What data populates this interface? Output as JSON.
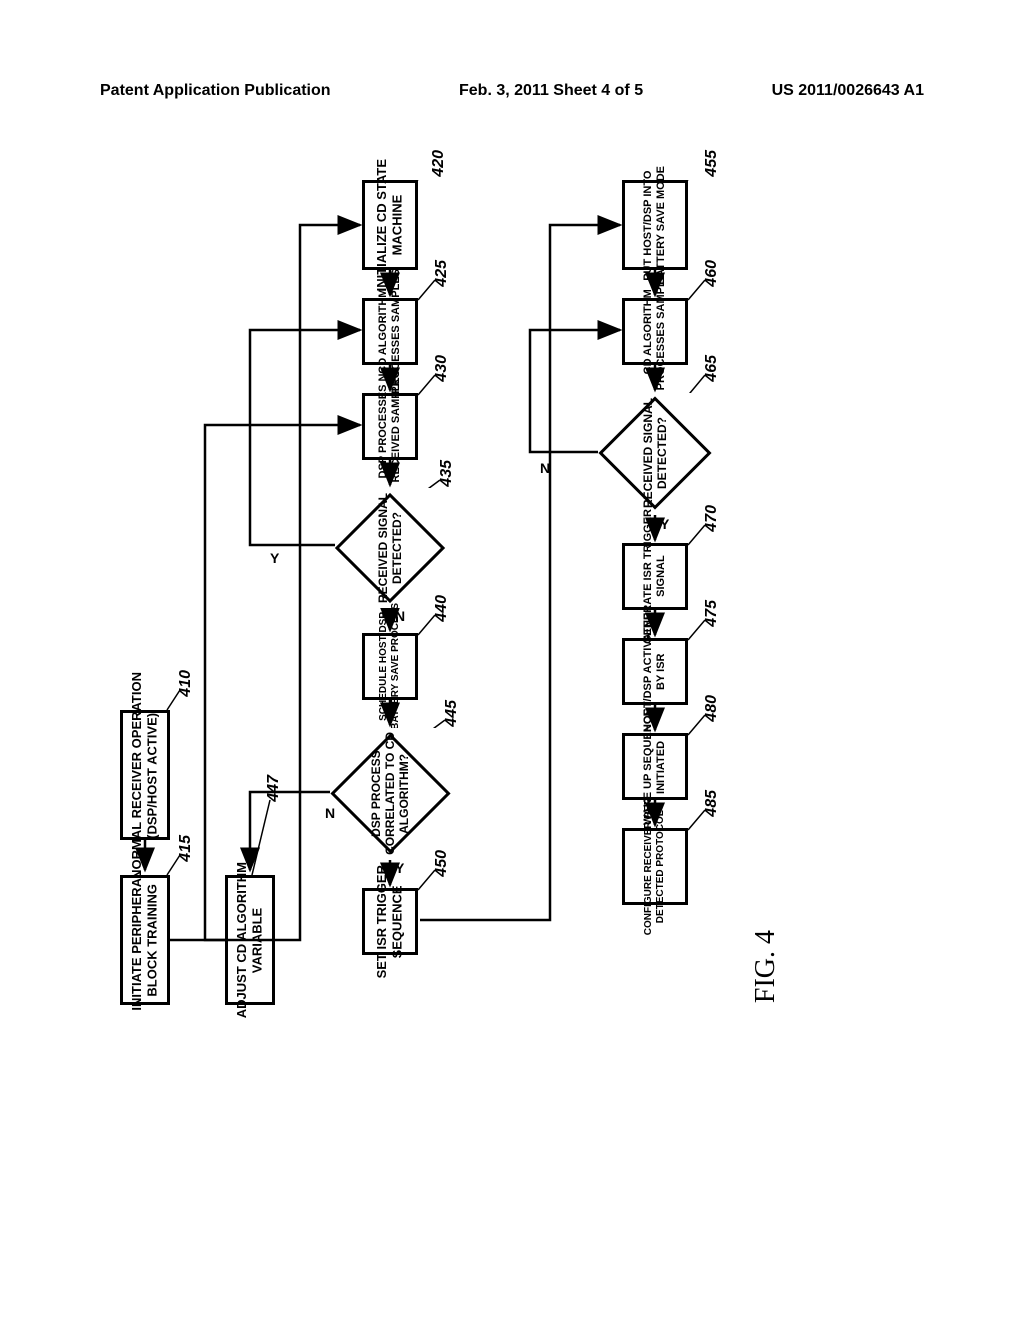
{
  "header": {
    "left": "Patent Application Publication",
    "center": "Feb. 3, 2011  Sheet 4 of 5",
    "right": "US 2011/0026643 A1"
  },
  "figure_label": "FIG. 4",
  "boxes": {
    "b410": "NORMAL RECEIVER OPERATION\n(DSP/HOST ACTIVE)",
    "b415": "INITIATE PERIPHERAL\nBLOCK TRAINING",
    "b420": "INITIALIZE CD STATE\nMACHINE",
    "b425": "CD ALGORITHM\nPROCESSES SAMPLES",
    "b430": "DSP PROCESSES N\nRECEIVED SAMPLES",
    "b435": "RECEIVED SIGNAL\nDETECTED?",
    "b440": "SCHEDULE HOST/DSP\nBATTERY SAVE PROCESS",
    "b445": "DSP PROCESS\nCORRELATED TO CD\nALGORITHM?",
    "b447": "ADJUST CD ALGORITHM\nVARIABLE",
    "b450": "SET ISR TRIGGER\nSEQUENCE",
    "b455": "PUT HOST/DSP INTO\nBATTERY SAVE MODE",
    "b460": "CD ALGORITHM\nPROCESSES SAMPLE",
    "b465": "RECEIVED SIGNAL\nDETECTED?",
    "b470": "GENERATE ISR TRIGGER\nSIGNAL",
    "b475": "HOST/DSP ACTIVATED\nBY ISR",
    "b480": "WAKE UP SEQUENCE\nINITIATED",
    "b485": "CONFIGURE RECEIVER PER\nDETECTED PROTOCOL"
  },
  "refs": {
    "r410": "410",
    "r415": "415",
    "r420": "420",
    "r425": "425",
    "r430": "430",
    "r435": "435",
    "r440": "440",
    "r445": "445",
    "r447": "447",
    "r450": "450",
    "r455": "455",
    "r460": "460",
    "r465": "465",
    "r470": "470",
    "r475": "475",
    "r480": "480",
    "r485": "485"
  },
  "labels": {
    "yes": "Y",
    "no": "N"
  }
}
